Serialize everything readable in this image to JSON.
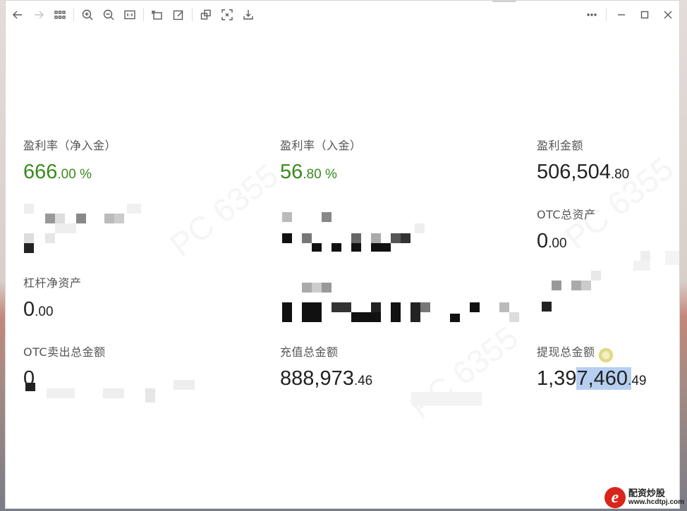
{
  "toolbar": {
    "left_icons": [
      "back-icon",
      "forward-icon",
      "grid-view-icon",
      "zoom-in-icon",
      "zoom-out-icon",
      "actual-size-icon",
      "rotate-icon",
      "edit-icon",
      "copy-icon",
      "fit-screen-icon",
      "download-icon"
    ],
    "right_icons": [
      "more-icon",
      "minimize-icon",
      "maximize-icon",
      "close-icon"
    ]
  },
  "stats": {
    "profit_rate_net": {
      "label": "盈利率（净入金）",
      "int": "666",
      "dec": ".00",
      "suffix": " %"
    },
    "profit_rate_deposit": {
      "label": "盈利率（入金）",
      "int": "56",
      "dec": ".80",
      "suffix": " %"
    },
    "profit_amount": {
      "label": "盈利金额",
      "int": "506,504",
      "dec": ".80"
    },
    "otc_total_assets": {
      "label": "OTC总资产",
      "int": "0",
      "dec": ".00"
    },
    "leverage_net_assets": {
      "label": "杠杆净资产",
      "int": "0",
      "dec": ".00"
    },
    "otc_sell_total": {
      "label": "OTC卖出总金额",
      "int": "0"
    },
    "deposit_total": {
      "label": "充值总金额",
      "int": "888,973",
      "dec": ".46"
    },
    "withdraw_total": {
      "label": "提现总金额",
      "int_a": "1,39",
      "int_b": "7,460",
      "dec_a": ".",
      "dec_b": "49"
    }
  },
  "colors": {
    "accent_green": "#3a8a1d",
    "selection": "#b6cff1",
    "logo_red": "#d8261c"
  },
  "logo": {
    "mark": "e",
    "name": "配资炒股",
    "url": "www.hcdtpj.com"
  }
}
